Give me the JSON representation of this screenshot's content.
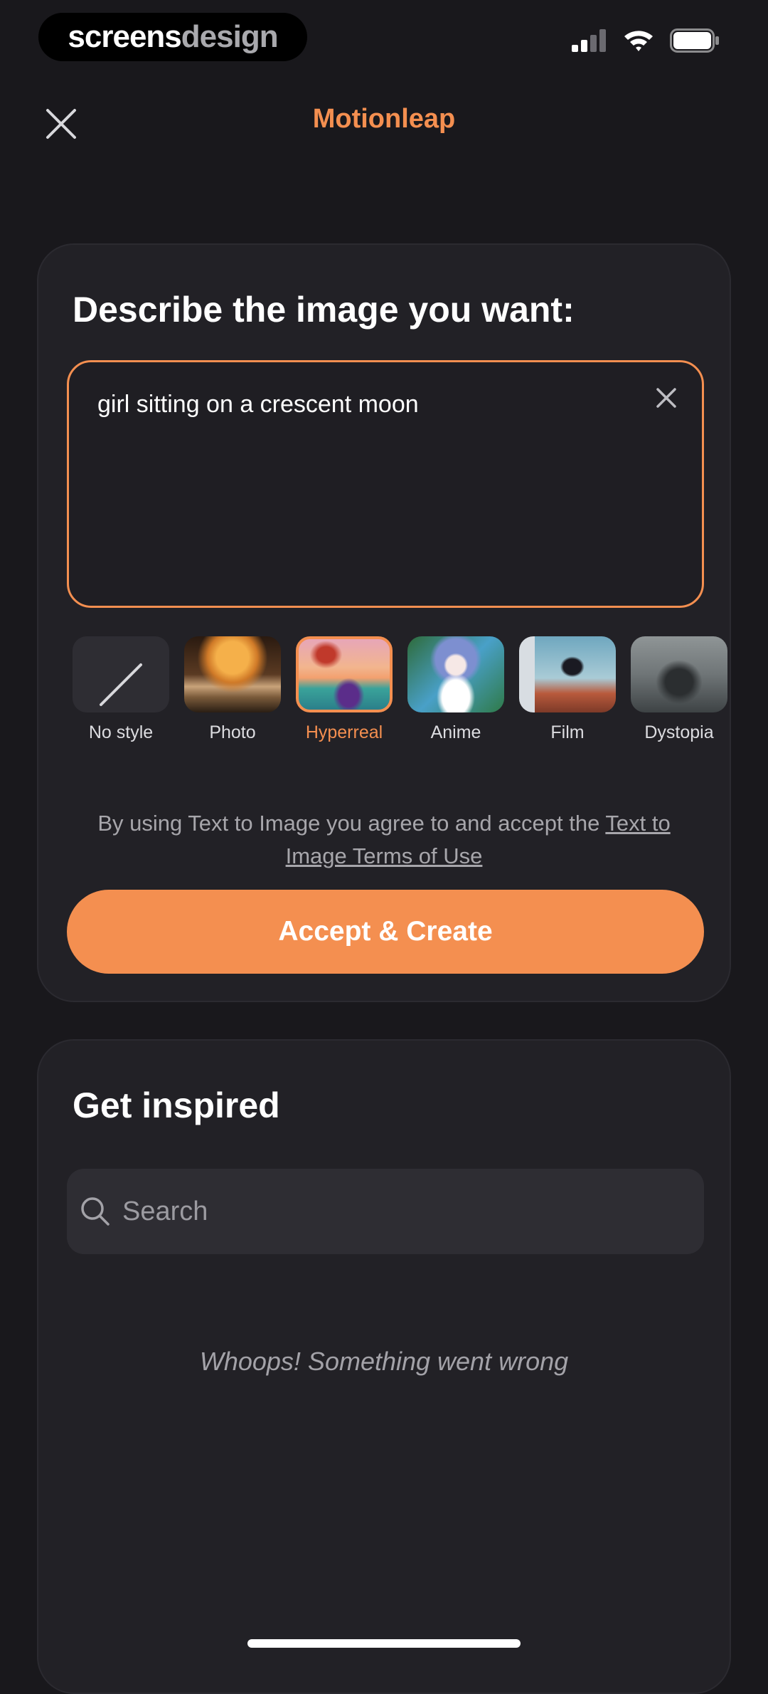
{
  "status_bar": {
    "watermark_part1": "screens",
    "watermark_part2": "design",
    "icons": [
      "signal-icon",
      "wifi-icon",
      "battery-icon"
    ]
  },
  "header": {
    "title": "Motionleap",
    "close_icon": "close-icon"
  },
  "describe": {
    "heading": "Describe the image you want:",
    "prompt_value": "girl sitting on a crescent moon",
    "clear_icon": "close-icon"
  },
  "styles": [
    {
      "label": "No style",
      "selected": false
    },
    {
      "label": "Photo",
      "selected": false
    },
    {
      "label": "Hyperreal",
      "selected": true
    },
    {
      "label": "Anime",
      "selected": false
    },
    {
      "label": "Film",
      "selected": false
    },
    {
      "label": "Dystopia",
      "selected": false
    }
  ],
  "terms": {
    "text": "By using Text to Image you agree to and accept the ",
    "link": "Text to Image Terms of Use"
  },
  "cta": {
    "label": "Accept & Create"
  },
  "inspired": {
    "heading": "Get inspired",
    "search_placeholder": "Search",
    "error_message": "Whoops! Something went wrong"
  },
  "colors": {
    "accent": "#f48f50",
    "background": "#19181c",
    "card": "#222126"
  }
}
